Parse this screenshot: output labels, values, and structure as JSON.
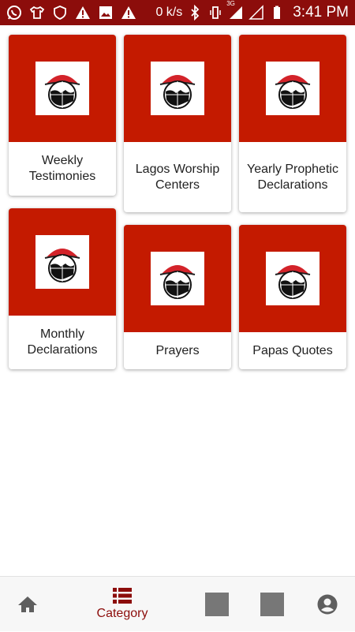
{
  "status_bar": {
    "network_speed": "0 k/s",
    "network_type": "3G",
    "time": "3:41 PM",
    "icons": [
      "whatsapp-icon",
      "shirt-icon",
      "shield-icon",
      "warning-icon",
      "image-icon",
      "warning-icon",
      "bluetooth-icon",
      "vibrate-icon",
      "signal-icon",
      "wifi-signal-icon",
      "battery-icon"
    ]
  },
  "categories": [
    {
      "label": "Weekly Testimonies"
    },
    {
      "label": "Lagos Worship Centers"
    },
    {
      "label": "Yearly Prophetic Declarations"
    },
    {
      "label": "Monthly Declarations"
    },
    {
      "label": "Prayers"
    },
    {
      "label": "Papas Quotes"
    }
  ],
  "bottom_nav": {
    "home_icon": "home-icon",
    "category_label": "Category",
    "category_icon": "list-icon",
    "account_icon": "account-circle-icon"
  },
  "colors": {
    "status_bar": "#8c0d0b",
    "card_image_bg": "#c41a00",
    "active_nav": "#8c0d0b"
  }
}
